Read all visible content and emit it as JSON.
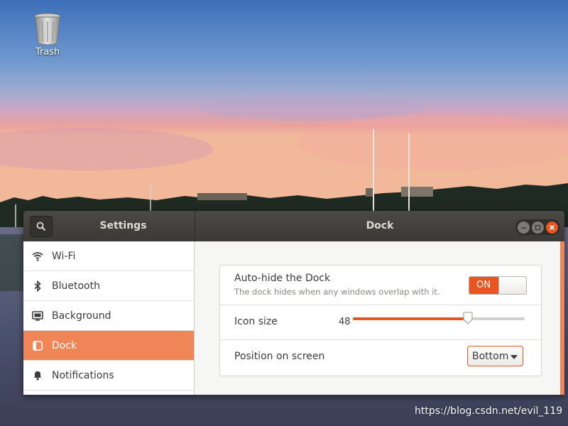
{
  "desktop": {
    "trash_label": "Trash",
    "watermark": "https://blog.csdn.net/evil_119"
  },
  "window": {
    "sidebar_title": "Settings",
    "panel_title": "Dock",
    "controls": [
      "minimize",
      "maximize",
      "close"
    ]
  },
  "sidebar": {
    "items": [
      {
        "label": "Wi-Fi",
        "icon": "wifi-icon",
        "active": false
      },
      {
        "label": "Bluetooth",
        "icon": "bluetooth-icon",
        "active": false
      },
      {
        "label": "Background",
        "icon": "background-icon",
        "active": false
      },
      {
        "label": "Dock",
        "icon": "dock-icon",
        "active": true
      },
      {
        "label": "Notifications",
        "icon": "bell-icon",
        "active": false
      }
    ]
  },
  "dock": {
    "autohide": {
      "title": "Auto-hide the Dock",
      "subtitle": "The dock hides when any windows overlap with it.",
      "state_label": "ON"
    },
    "icon_size": {
      "title": "Icon size",
      "value": "48",
      "fraction": 0.67
    },
    "position": {
      "title": "Position on screen",
      "selected": "Bottom"
    }
  },
  "colors": {
    "accent": "#e95420",
    "active_item": "#f08658",
    "headerbar": "#3d3c39"
  }
}
